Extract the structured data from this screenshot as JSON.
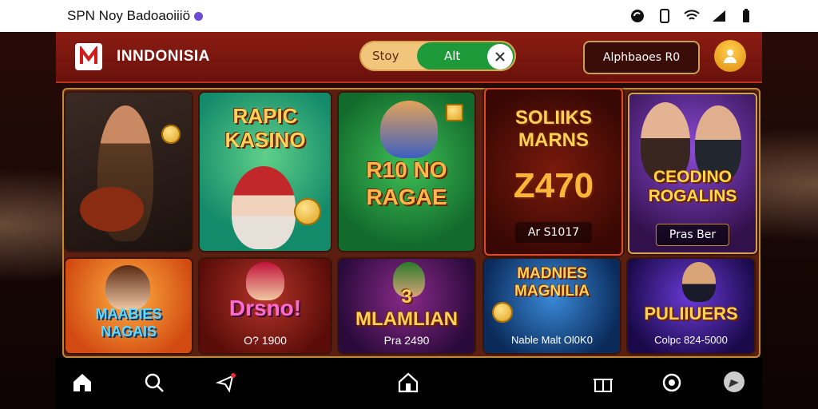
{
  "statusbar": {
    "title": "SPN Noy Badoaoiiiö",
    "icons": [
      "sync-icon",
      "phone-icon",
      "wifi-icon",
      "signal-icon",
      "battery-icon"
    ]
  },
  "header": {
    "logo_icon": "brand-logo",
    "brand": "INNDONISIA",
    "toggle": {
      "option_1": "Stoy",
      "option_2": "Alt",
      "close_icon": "close-icon"
    },
    "account": "Alphbaoes R0",
    "avatar_icon": "user-icon"
  },
  "games": [
    {
      "title": "",
      "caption": ""
    },
    {
      "title": "RAPIC KASINO",
      "caption": ""
    },
    {
      "title": "R10 NO RAGAE",
      "caption": ""
    },
    {
      "title": "SOLIIKS MARNS",
      "big": "Z470",
      "caption": "Ar S1017"
    },
    {
      "title": "CEODINO ROGALINS",
      "caption": "Pras Ber"
    },
    {
      "title": "MAABIES NAGAIS",
      "caption": ""
    },
    {
      "title": "Drsno!",
      "caption": "O? 1900"
    },
    {
      "title": "3 MLAMLIAN",
      "caption": "Pra 2490"
    },
    {
      "title": "MADNIES MAGNILIA",
      "caption": "Nable Malt Ol0K0"
    },
    {
      "title": "PULIIUERS",
      "caption": "Colpc 824-5000"
    }
  ],
  "nav": {
    "items": [
      "home-icon",
      "search-icon",
      "promo-icon",
      "store-icon",
      "gift-icon",
      "settings-icon",
      "chat-icon"
    ]
  },
  "colors": {
    "accent": "#8b1c12",
    "gold": "#ffd257",
    "green": "#1f9a3a"
  }
}
